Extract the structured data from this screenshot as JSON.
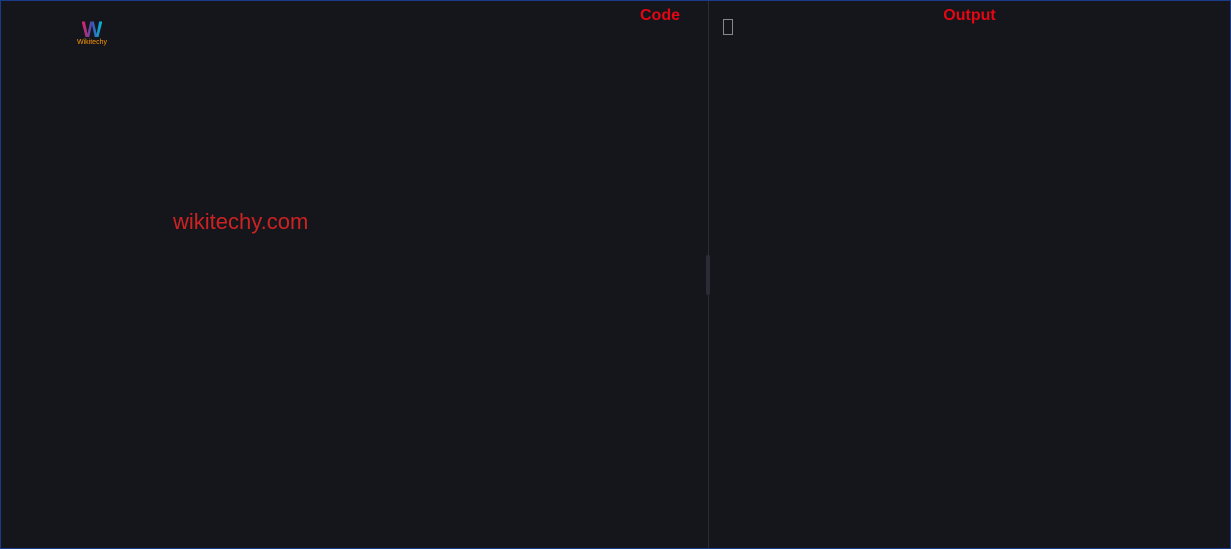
{
  "panels": {
    "left": {
      "title": "Code",
      "watermark": "wikitechy.com",
      "logo": {
        "letter": "W",
        "subtext": "Wikitechy"
      }
    },
    "right": {
      "title": "Output",
      "content": ""
    }
  }
}
